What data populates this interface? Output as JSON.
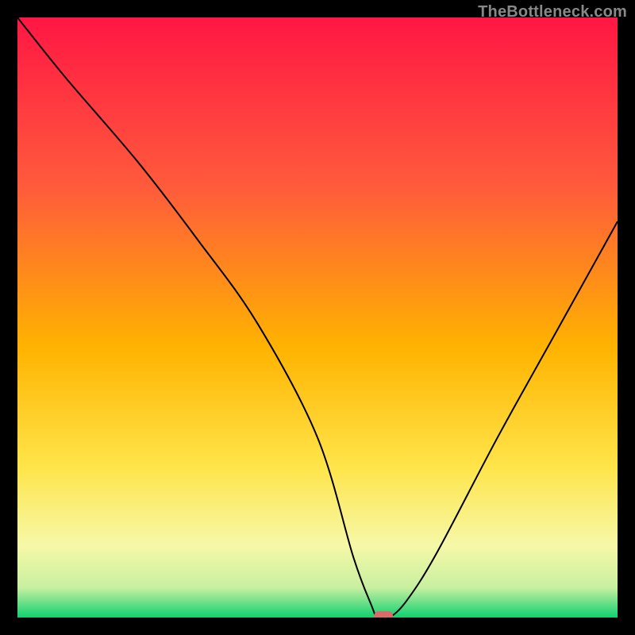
{
  "watermark": "TheBottleneck.com",
  "chart_data": {
    "type": "line",
    "title": "",
    "xlabel": "",
    "ylabel": "",
    "xlim": [
      0,
      100
    ],
    "ylim": [
      0,
      100
    ],
    "grid": false,
    "series": [
      {
        "name": "bottleneck-curve",
        "x": [
          0,
          8,
          20,
          30,
          40,
          50,
          56,
          59,
          60,
          62,
          65,
          70,
          80,
          90,
          100
        ],
        "values": [
          100,
          90,
          76,
          63,
          49,
          30,
          10,
          2,
          0,
          0,
          3,
          11,
          30,
          48,
          66
        ]
      }
    ],
    "marker": {
      "x": 61,
      "y": 0,
      "color": "#d96b6b"
    },
    "gradient_stops": [
      {
        "offset": 0.0,
        "color": "#ff1744"
      },
      {
        "offset": 0.28,
        "color": "#ff5a3c"
      },
      {
        "offset": 0.55,
        "color": "#ffb300"
      },
      {
        "offset": 0.75,
        "color": "#ffe54a"
      },
      {
        "offset": 0.88,
        "color": "#f6f8a8"
      },
      {
        "offset": 0.95,
        "color": "#c8f0a0"
      },
      {
        "offset": 1.0,
        "color": "#10d070"
      }
    ],
    "line_color": "#000000",
    "line_width": 2
  }
}
